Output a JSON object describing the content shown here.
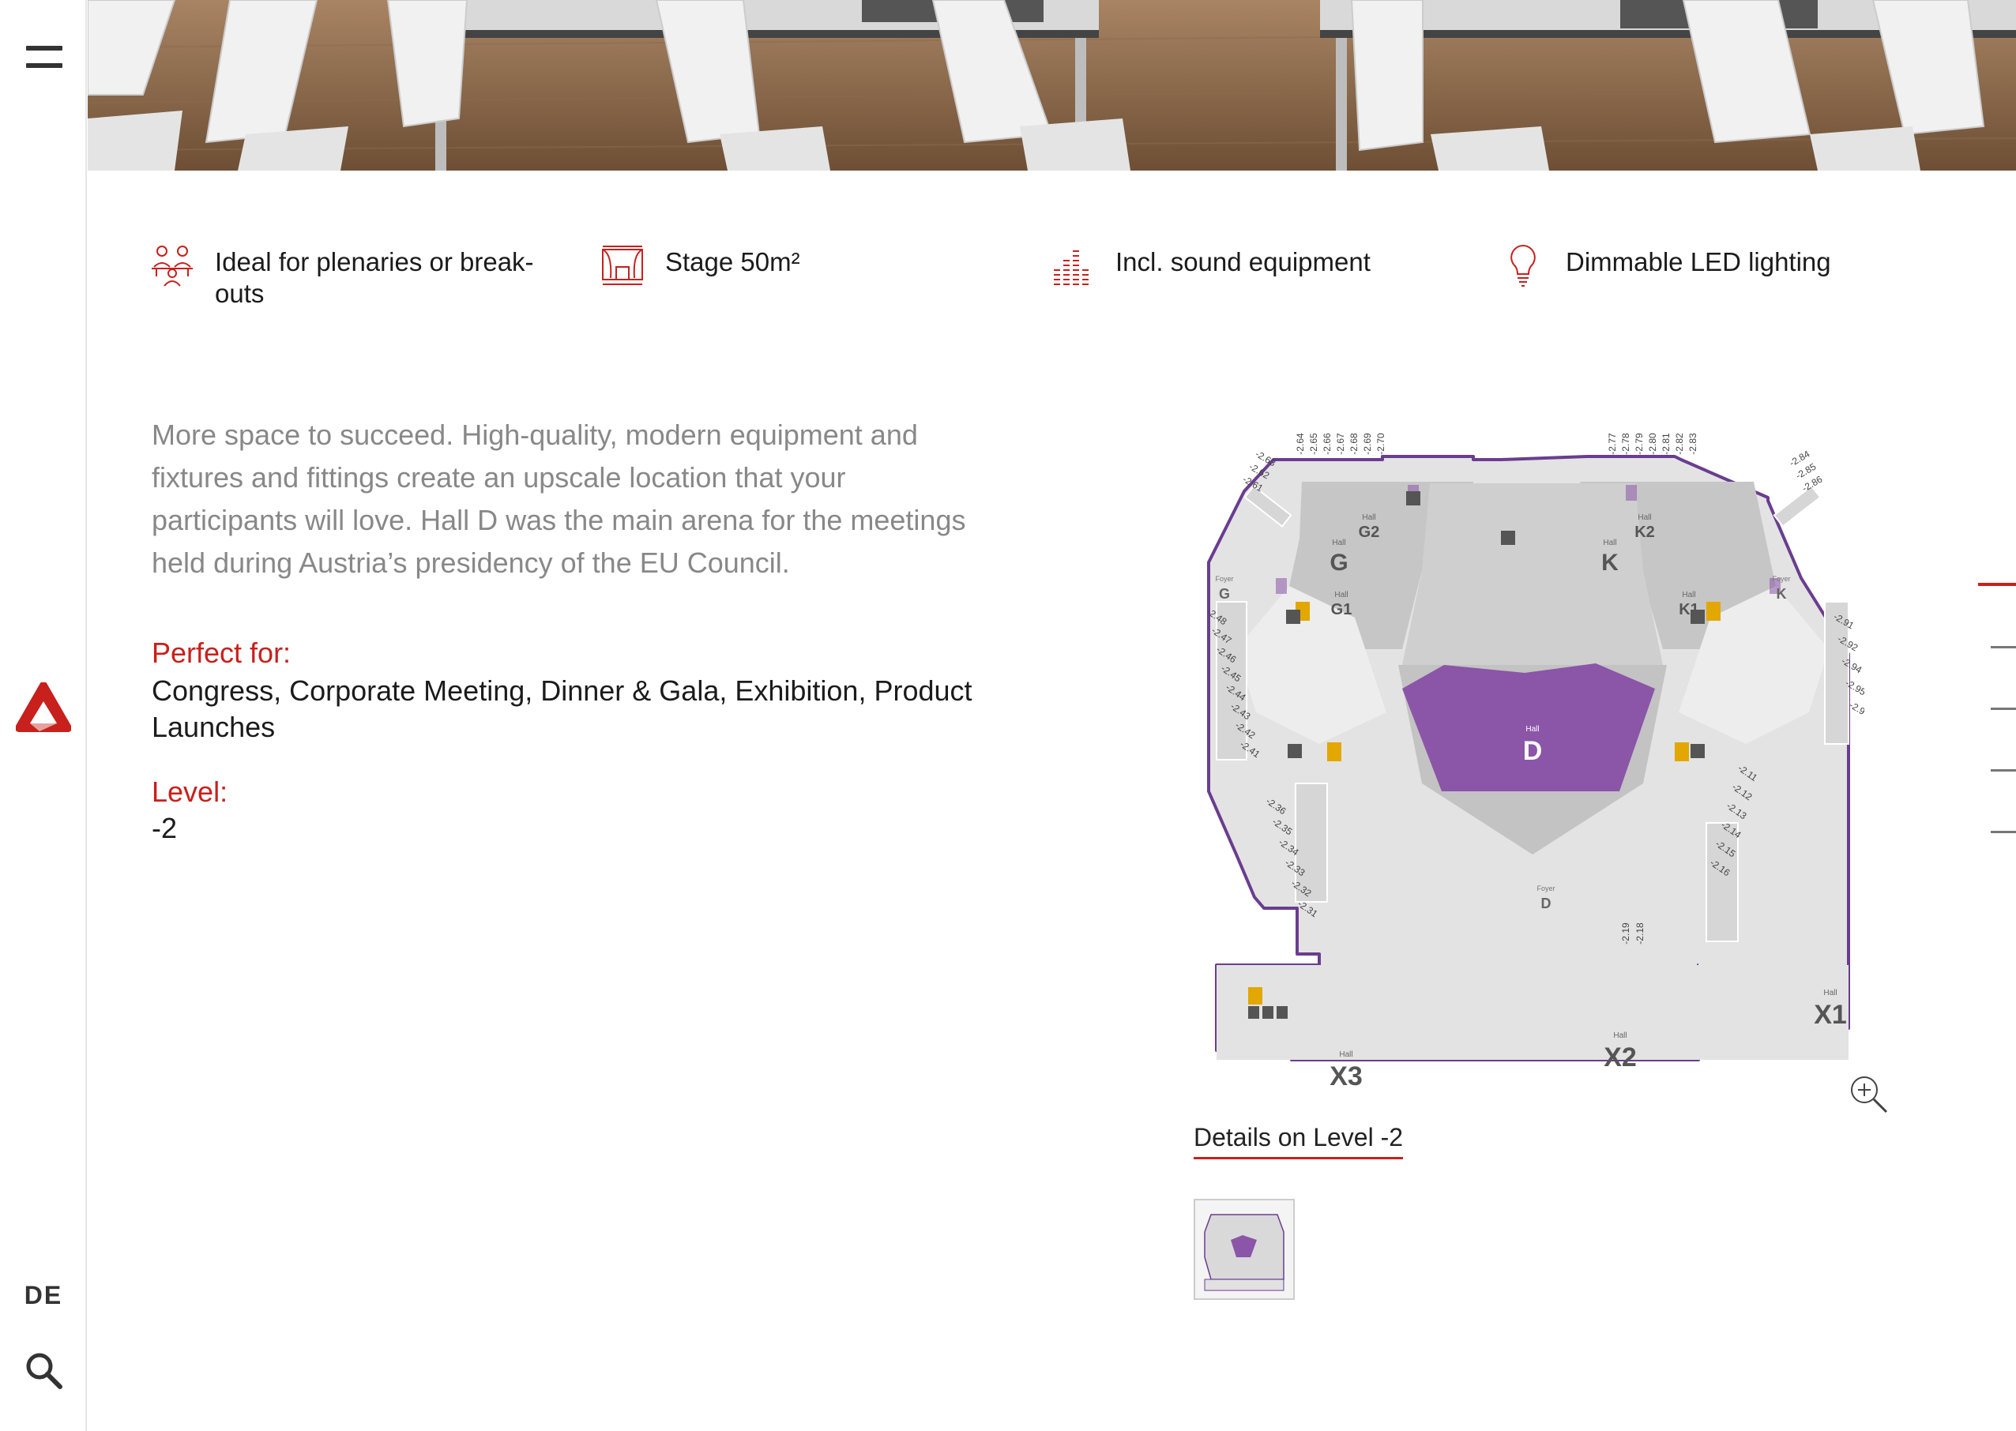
{
  "sidebar": {
    "language": "DE"
  },
  "features": [
    {
      "icon": "people-icon",
      "label": "Ideal for plenaries or break-outs",
      "line1": "Ideal for plenaries or break-",
      "line2": "outs"
    },
    {
      "icon": "stage-icon",
      "label": "Stage 50m²"
    },
    {
      "icon": "sound-equipment-icon",
      "label": "Incl. sound equipment"
    },
    {
      "icon": "lightbulb-icon",
      "label": "Dimmable LED lighting"
    }
  ],
  "description": "More space to succeed. High-quality, modern equipment and fixtures and fittings create an upscale location that your participants will love. Hall D was the main arena for the meetings held during Austria’s presidency of the EU Council.",
  "perfect_for": {
    "label": "Perfect for:",
    "value": "Congress, Corporate Meeting, Dinner & Gala, Exhibition, Product Launches"
  },
  "level": {
    "label": "Level:",
    "value": "-2"
  },
  "floorplan": {
    "halls": [
      {
        "prefix": "Hall",
        "name": "G"
      },
      {
        "prefix": "Hall",
        "name": "G2"
      },
      {
        "prefix": "Hall",
        "name": "G1"
      },
      {
        "prefix": "Hall",
        "name": "K"
      },
      {
        "prefix": "Hall",
        "name": "K2"
      },
      {
        "prefix": "Hall",
        "name": "K1"
      },
      {
        "prefix": "Hall",
        "name": "D"
      },
      {
        "prefix": "Hall",
        "name": "X1"
      },
      {
        "prefix": "Hall",
        "name": "X2"
      },
      {
        "prefix": "Hall",
        "name": "X3"
      }
    ],
    "foyers": [
      {
        "prefix": "Foyer",
        "name": "G"
      },
      {
        "prefix": "Foyer",
        "name": "K"
      },
      {
        "prefix": "Foyer",
        "name": "D"
      }
    ],
    "rooms_top_left": [
      "-2.64",
      "-2.65",
      "-2.66",
      "-2.67",
      "-2.68",
      "-2.69",
      "-2.70"
    ],
    "rooms_top_right": [
      "-2.77",
      "-2.78",
      "-2.79",
      "-2.80",
      "-2.81",
      "-2.82",
      "-2.83"
    ],
    "rooms_upper_left": [
      "-2.63",
      "-2.62",
      "-2.61"
    ],
    "rooms_upper_right": [
      "-2.84",
      "-2.85",
      "-2.86"
    ],
    "rooms_left": [
      "-2.48",
      "-2.47",
      "-2.46",
      "-2.45",
      "-2.44",
      "-2.43",
      "-2.42",
      "-2.41"
    ],
    "rooms_lower_left": [
      "-2.36",
      "-2.35",
      "-2.34",
      "-2.33",
      "-2.32",
      "-2.31"
    ],
    "rooms_right": [
      "-2.91",
      "-2.92",
      "-2.94",
      "-2.95",
      "-2.97"
    ],
    "rooms_lower_right": [
      "-2.11",
      "-2.12",
      "-2.13",
      "-2.14",
      "-2.15",
      "-2.16"
    ],
    "rooms_bottom": [
      "-2.19",
      "-2.18"
    ]
  },
  "details_link": "Details on Level -2",
  "colors": {
    "accent": "#c8201c",
    "hall_highlight": "#8b55a8",
    "outline": "#6a3d8f",
    "hall_grey": "#c9c9c9"
  }
}
